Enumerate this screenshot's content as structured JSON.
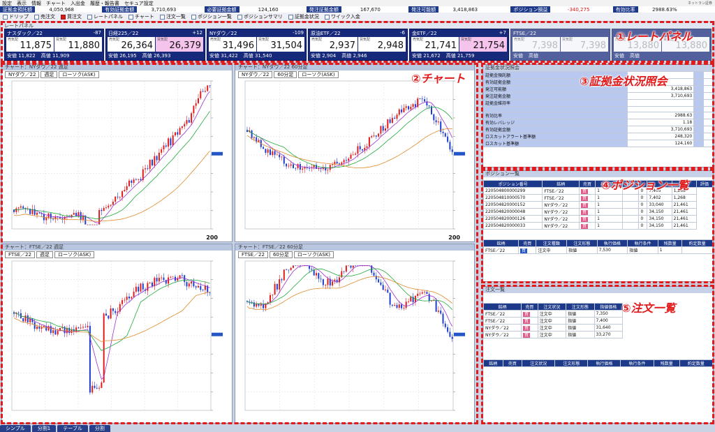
{
  "menu": [
    "設定",
    "表示",
    "情報",
    "チャート",
    "入出金",
    "履歴・報告書",
    "セキュア設定"
  ],
  "logo_text": "ネットラン証券",
  "account": [
    {
      "label": "証拠金預託額",
      "value": "4,050,968"
    },
    {
      "label": "有効証拠金額",
      "value": "3,710,693"
    },
    {
      "label": "必要証拠金額",
      "value": "124,160"
    },
    {
      "label": "発注証拠金額",
      "value": "167,670"
    },
    {
      "label": "発注可能額",
      "value": "3,418,863"
    },
    {
      "label": "ポジション損益",
      "value": "-340,275",
      "neg": true
    },
    {
      "label": "有効比率",
      "value": "2988.63%"
    }
  ],
  "toolbar": [
    {
      "label": "ドリップ",
      "icon": "drip-icon"
    },
    {
      "label": "売注文",
      "icon": "sell-order-icon"
    },
    {
      "label": "買注文",
      "icon": "buy-order-icon",
      "red": true
    },
    {
      "label": "レートパネル",
      "icon": "rate-panel-icon"
    },
    {
      "label": "チャート",
      "icon": "chart-icon"
    },
    {
      "label": "注文一覧",
      "icon": "order-list-icon"
    },
    {
      "label": "ポジション一覧",
      "icon": "position-list-icon"
    },
    {
      "label": "ポジションサマリ",
      "icon": "position-summary-icon"
    },
    {
      "label": "証拠金状況",
      "icon": "margin-status-icon"
    },
    {
      "label": "ワイック入金",
      "icon": "quick-deposit-icon"
    }
  ],
  "rate_panel_title": "レートパネル",
  "rates": [
    {
      "name": "ナスダック／22",
      "chg": "-87",
      "bid_label": "売気配",
      "bid": "11,875",
      "ask_label": "買気配",
      "ask": "11,880",
      "low": "安値 11,822",
      "high": "高値 11,909"
    },
    {
      "name": "日経225／22",
      "chg": "+12",
      "bid_label": "売気配",
      "bid": "26,364",
      "ask_label": "買気配",
      "ask": "26,379",
      "low": "安値 26,195",
      "high": "高値 26,393",
      "pink": true
    },
    {
      "name": "NYダウ／22",
      "chg": "-109",
      "bid_label": "売気配",
      "bid": "31,496",
      "ask_label": "買気配",
      "ask": "31,504",
      "low": "安値 31,422",
      "high": "高値 31,540"
    },
    {
      "name": "原油ETF／22",
      "chg": "-6",
      "bid_label": "売気配",
      "bid": "2,937",
      "ask_label": "買気配",
      "ask": "2,948",
      "low": "安値 2,904",
      "high": "高値 2,946"
    },
    {
      "name": "金ETF／22",
      "chg": "+7",
      "bid_label": "売気配",
      "bid": "21,741",
      "ask_label": "買気配",
      "ask": "21,754",
      "low": "安値 21,672",
      "high": "高値 21,759",
      "pink": true
    },
    {
      "name": "FTSE／22",
      "chg": "",
      "bid_label": "売気配",
      "bid": "7,398",
      "ask_label": "買気配",
      "ask": "7,398",
      "low": "安値",
      "high": "高値",
      "dim": true
    },
    {
      "name": "",
      "chg": "",
      "bid_label": "売気配",
      "bid": "13,880",
      "ask_label": "買気配",
      "ask": "13,880",
      "low": "安値",
      "high": "高値",
      "dim": true
    }
  ],
  "charts": [
    {
      "title": "チャート：NYダウ／22 週足",
      "sym": "NYダウ／22",
      "tf": "週足",
      "type": "ローソク(ASK)",
      "count": "200"
    },
    {
      "title": "チャート：NYダウ／22 60分足",
      "sym": "NYダウ／22",
      "tf": "60分足",
      "type": "ローソク(ASK)",
      "count": "200"
    },
    {
      "title": "チャート：FTSE／22 週足",
      "sym": "FTSE／22",
      "tf": "週足",
      "type": "ローソク(ASK)",
      "count": ""
    },
    {
      "title": "チャート：FTSE／22 60分足",
      "sym": "FTSE／22",
      "tf": "60分足",
      "type": "ローソク(ASK)",
      "count": ""
    }
  ],
  "margin": {
    "title": "証拠金状況照会",
    "rows": [
      [
        "証拠金預託額",
        ""
      ],
      [
        "有効証拠金額",
        ""
      ],
      [
        "発注可能額",
        "3,418,863"
      ],
      [
        "発注証拠金額",
        "3,710,693"
      ],
      [
        "証拠金維持率",
        ""
      ],
      [
        "",
        ""
      ],
      [
        "有効比率",
        "2988.63"
      ],
      [
        "有効レバレッジ",
        "1.18"
      ],
      [
        "有効証拠金額",
        "3,710,693"
      ],
      [
        "ロスカットアラート基準額",
        "248,320"
      ],
      [
        "ロスカット基準額",
        "124,160"
      ]
    ]
  },
  "positions": {
    "title": "ポジション一覧",
    "headers": [
      "ポジション番号",
      "銘柄",
      "売買",
      "状況区分",
      "数量",
      "",
      "",
      "建値",
      "評価"
    ],
    "rows": [
      [
        "220504800000299",
        "FTSE／22",
        "買",
        "1",
        "",
        "0",
        "7,405",
        "1,268"
      ],
      [
        "220504810000570",
        "FTSE／22",
        "買",
        "1",
        "",
        "0",
        "7,402",
        "1,268"
      ],
      [
        "220504820000152",
        "NYダウ／22",
        "買",
        "1",
        "",
        "0",
        "33,040",
        "21,461"
      ],
      [
        "220504820000048",
        "NYダウ／22",
        "買",
        "1",
        "",
        "0",
        "34,150",
        "21,461"
      ],
      [
        "220504820000126",
        "NYダウ／22",
        "買",
        "1",
        "",
        "0",
        "34,150",
        "21,461"
      ],
      [
        "220504820000033",
        "NYダウ／22",
        "買",
        "1",
        "",
        "0",
        "34,150",
        "21,461"
      ]
    ],
    "sub_headers": [
      "銘柄",
      "売買",
      "注文種類",
      "注文形態",
      "執行価格",
      "執行条件",
      "残数量",
      "約定数量"
    ],
    "sub_row": [
      "FTSE／22",
      "買",
      "注文中",
      "指値",
      "7,530",
      "指値",
      "1",
      ""
    ]
  },
  "orders": {
    "title": "注文一覧",
    "headers": [
      "銘柄",
      "売買",
      "注文状況",
      "注文形態",
      "指値価格"
    ],
    "rows": [
      [
        "FTSE／22",
        "買",
        "注文中",
        "指値",
        "7,350"
      ],
      [
        "FTSE／22",
        "買",
        "注文中",
        "指値",
        "7,400"
      ],
      [
        "NYダウ／22",
        "買",
        "注文中",
        "指値",
        "31,640"
      ],
      [
        "NYダウ／22",
        "買",
        "注文中",
        "指値",
        "33,270"
      ]
    ],
    "sub_headers": [
      "銘柄",
      "売買",
      "注文状況",
      "注文形態",
      "執行価格",
      "執行条件",
      "残数量",
      "約定数量"
    ]
  },
  "callouts": {
    "rate": "①レートパネル",
    "chart": "②チャート",
    "margin": "③証拠金状況照会",
    "position": "④ポジション一覧",
    "order": "⑤注文一覧"
  },
  "tabs": [
    "シンプル",
    "分割1",
    "テーブル",
    "分割"
  ],
  "colors": {
    "navy": "#1d3a8a",
    "accent_red": "#e11b1b",
    "candle_up": "#e11b1b",
    "candle_down": "#1c3fd1"
  }
}
